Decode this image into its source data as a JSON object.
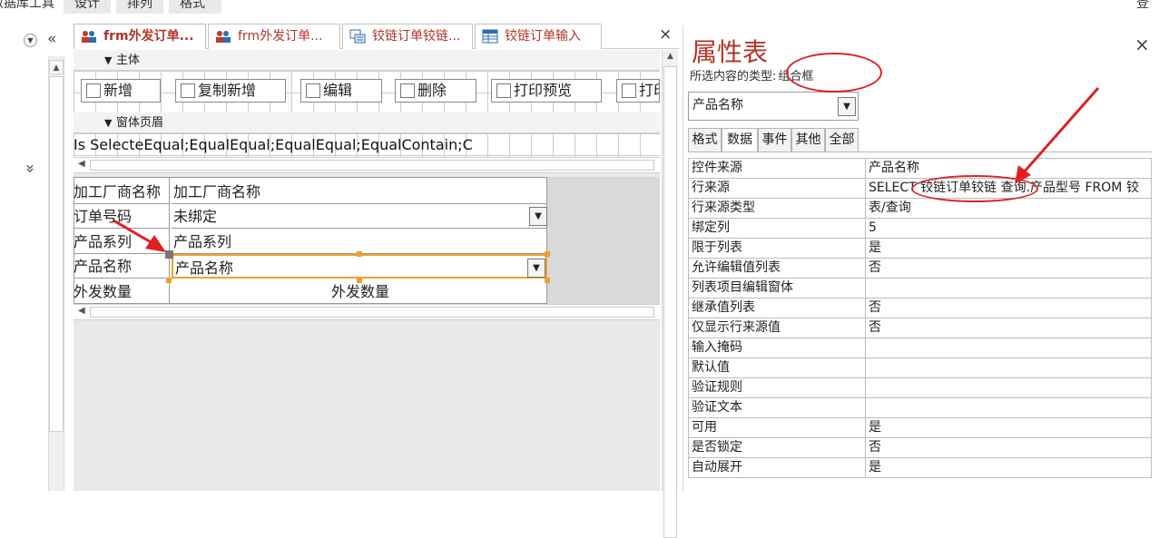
{
  "ribbon": {
    "tabs": [
      "数据库工具",
      "设计",
      "排列",
      "格式"
    ],
    "right_label": "登录"
  },
  "nav": {
    "expand_glyph": "«",
    "collapse_glyph": "»"
  },
  "doc_tabs": [
    {
      "label": "frm外发订单...",
      "active": true
    },
    {
      "label": "frm外发订单..."
    },
    {
      "label": "铰链订单铰链..."
    },
    {
      "label": "铰链订单输入"
    }
  ],
  "doc_close": "×",
  "sections": {
    "main": "主体",
    "header": "窗体页眉"
  },
  "toolbar_buttons": [
    "新增",
    "复制新增",
    "编辑",
    "删除",
    "打印预览",
    "打印"
  ],
  "header_row_text": "Is SelecteEqual;EqualEqual;EqualEqual;EqualContain;Co",
  "detail_fields": [
    {
      "label": "加工厂商名称",
      "value": "加工厂商名称",
      "dropdown": false
    },
    {
      "label": "订单号码",
      "value": "未绑定",
      "dropdown": true
    },
    {
      "label": "产品系列",
      "value": "产品系列",
      "dropdown": false
    },
    {
      "label": "产品名称",
      "value": "产品名称",
      "dropdown": true
    },
    {
      "label": "外发数量",
      "value": "外发数量",
      "dropdown": false
    }
  ],
  "property_sheet": {
    "title": "属性表",
    "close": "×",
    "type_label": "所选内容的类型:",
    "type_value": "组合框",
    "selected_control": "产品名称",
    "tabs": [
      "格式",
      "数据",
      "事件",
      "其他",
      "全部"
    ],
    "active_tab": "数据",
    "rows": [
      {
        "key": "控件来源",
        "value": "产品名称"
      },
      {
        "key": "行来源",
        "value": "SELECT 铰链订单铰链 查询.产品型号 FROM 铰"
      },
      {
        "key": "行来源类型",
        "value": "表/查询"
      },
      {
        "key": "绑定列",
        "value": "5"
      },
      {
        "key": "限于列表",
        "value": "是"
      },
      {
        "key": "允许编辑值列表",
        "value": "否"
      },
      {
        "key": "列表项目编辑窗体",
        "value": ""
      },
      {
        "key": "继承值列表",
        "value": "否"
      },
      {
        "key": "仅显示行来源值",
        "value": "否"
      },
      {
        "key": "输入掩码",
        "value": ""
      },
      {
        "key": "默认值",
        "value": ""
      },
      {
        "key": "验证规则",
        "value": ""
      },
      {
        "key": "验证文本",
        "value": ""
      },
      {
        "key": "可用",
        "value": "是"
      },
      {
        "key": "是否锁定",
        "value": "否"
      },
      {
        "key": "自动展开",
        "value": "是"
      }
    ]
  },
  "colors": {
    "accent": "#b3342a",
    "annotation": "#d9262b",
    "selection": "#f0a030"
  }
}
